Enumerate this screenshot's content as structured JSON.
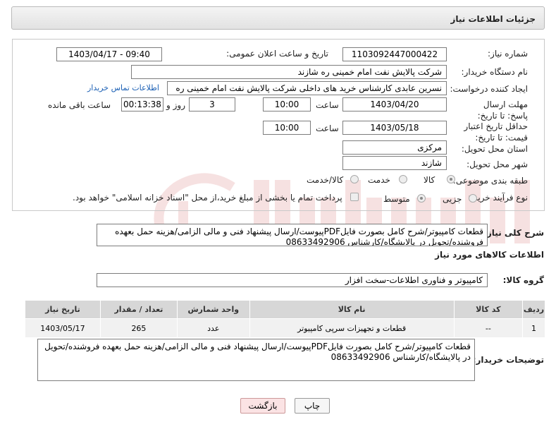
{
  "header": {
    "title": "جزئیات اطلاعات نیاز"
  },
  "form": {
    "need_number": {
      "label": "شماره نیاز:",
      "value": "1103092447000422"
    },
    "announce_datetime": {
      "label": "تاریخ و ساعت اعلان عمومی:",
      "value": "1403/04/17 - 09:40"
    },
    "buyer_org": {
      "label": "نام دستگاه خریدار:",
      "value": "شرکت پالایش نفت امام خمینی  ره  شازند"
    },
    "requester": {
      "label": "ایجاد کننده درخواست:",
      "value": "نسرین عابدی کارشناس خرید های داخلی  شرکت پالایش نفت امام خمینی  ره",
      "link": "اطلاعات تماس خریدار"
    },
    "reply_deadline": {
      "label": "مهلت ارسال پاسخ: تا تاریخ:",
      "date": "1403/04/20",
      "time_label": "ساعت",
      "time": "10:00",
      "days": "3",
      "days_label": "روز و",
      "remaining": "00:13:38",
      "remaining_label": "ساعت باقی مانده"
    },
    "price_validity": {
      "label": "حداقل تاریخ اعتبار قیمت: تا تاریخ:",
      "date": "1403/05/18",
      "time_label": "ساعت",
      "time": "10:00"
    },
    "province": {
      "label": "استان محل تحویل:",
      "value": "مرکزی"
    },
    "city": {
      "label": "شهر محل تحویل:",
      "value": "شازند"
    },
    "category": {
      "label": "طبقه بندی موضوعی:",
      "options": [
        "کالا",
        "خدمت",
        "کالا/خدمت"
      ],
      "selected": "کالا"
    },
    "purchase_type": {
      "label": "نوع فرآیند خرید :",
      "options": [
        "جزیی",
        "متوسط"
      ],
      "selected": "متوسط",
      "payment_note": "پرداخت تمام یا بخشی از مبلغ خرید،از محل \"اسناد خزانه اسلامی\" خواهد بود."
    }
  },
  "description": {
    "label": "شرح کلی نیاز:",
    "text": "قطعات کامپیوتر/شرح کامل بصورت فایلPDFپیوست/ارسال پیشنهاد فنی و مالی الزامی/هزینه حمل بعهده فروشنده/تحویل در پالایشگاه/کارشناس 08633492906"
  },
  "goods_section": {
    "title": "اطلاعات کالاهای مورد نیاز",
    "group_label": "گروه کالا:",
    "group_value": "کامپیوتر و فناوری اطلاعات-سخت افزار"
  },
  "table": {
    "headers": [
      "ردیف",
      "کد کالا",
      "نام کالا",
      "واحد شمارش",
      "تعداد / مقدار",
      "تاریخ نیاز"
    ],
    "rows": [
      {
        "row": "1",
        "code": "--",
        "name": "قطعات و تجهیزات سرپی کامپیوتر",
        "unit": "عدد",
        "qty": "265",
        "date": "1403/05/17"
      }
    ]
  },
  "buyer_notes": {
    "label": "توضیحات خریدار:",
    "text": "قطعات کامپیوتر/شرح کامل بصورت فایلPDFپیوست/ارسال پیشنهاد فنی و مالی الزامی/هزینه حمل بعهده فروشنده/تحویل در پالایشگاه/کارشناس 08633492906"
  },
  "buttons": {
    "print": "چاپ",
    "back": "بازگشت"
  },
  "colors": {
    "back_button_bg": "#fbe3e4",
    "print_button_bg": "#f6f6f6",
    "link": "#1a5fb4"
  }
}
